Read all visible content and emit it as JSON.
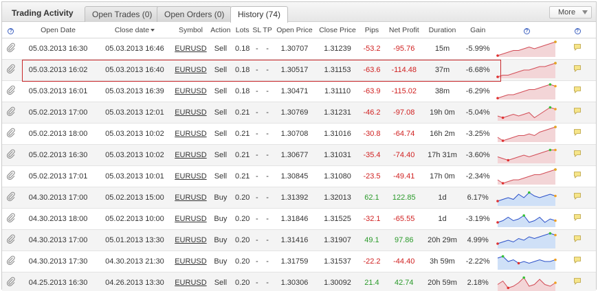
{
  "header": {
    "title": "Trading Activity",
    "tabs": [
      {
        "label": "Open Trades (0)"
      },
      {
        "label": "Open Orders (0)"
      },
      {
        "label": "History (74)"
      }
    ],
    "more_label": "More"
  },
  "columns": {
    "help": "?",
    "open_date": "Open Date",
    "close_date": "Close date",
    "symbol": "Symbol",
    "action": "Action",
    "lots": "Lots",
    "sl": "SL",
    "tp": "TP",
    "open_price": "Open Price",
    "close_price": "Close Price",
    "pips": "Pips",
    "net_profit": "Net Profit",
    "duration": "Duration",
    "gain": "Gain",
    "chart_help": "?",
    "note_help": "?"
  },
  "colors": {
    "sell_fill": "#f3d5d7",
    "sell_line": "#d24b55",
    "buy_fill": "#cfe0f7",
    "buy_line": "#2a4fc8",
    "high_marker": "#33c233",
    "low_marker": "#e03030",
    "end_marker": "#f0a020"
  },
  "rows": [
    {
      "open_date": "05.03.2013 16:30",
      "close_date": "05.03.2013 16:46",
      "symbol": "EURUSD",
      "action": "Sell",
      "lots": "0.18",
      "sl": "-",
      "tp": "-",
      "open_price": "1.30707",
      "close_price": "1.31239",
      "pips": "-53.2",
      "net_profit": "-95.76",
      "duration": "15m",
      "gain": "-5.99%"
    },
    {
      "open_date": "05.03.2013 16:02",
      "close_date": "05.03.2013 16:40",
      "symbol": "EURUSD",
      "action": "Sell",
      "lots": "0.18",
      "sl": "-",
      "tp": "-",
      "open_price": "1.30517",
      "close_price": "1.31153",
      "pips": "-63.6",
      "net_profit": "-114.48",
      "duration": "37m",
      "gain": "-6.68%"
    },
    {
      "open_date": "05.03.2013 16:01",
      "close_date": "05.03.2013 16:39",
      "symbol": "EURUSD",
      "action": "Sell",
      "lots": "0.18",
      "sl": "-",
      "tp": "-",
      "open_price": "1.30471",
      "close_price": "1.31110",
      "pips": "-63.9",
      "net_profit": "-115.02",
      "duration": "38m",
      "gain": "-6.29%"
    },
    {
      "open_date": "05.02.2013 17:00",
      "close_date": "05.03.2013 12:01",
      "symbol": "EURUSD",
      "action": "Sell",
      "lots": "0.21",
      "sl": "-",
      "tp": "-",
      "open_price": "1.30769",
      "close_price": "1.31231",
      "pips": "-46.2",
      "net_profit": "-97.08",
      "duration": "19h 0m",
      "gain": "-5.04%"
    },
    {
      "open_date": "05.02.2013 18:00",
      "close_date": "05.03.2013 10:02",
      "symbol": "EURUSD",
      "action": "Sell",
      "lots": "0.21",
      "sl": "-",
      "tp": "-",
      "open_price": "1.30708",
      "close_price": "1.31016",
      "pips": "-30.8",
      "net_profit": "-64.74",
      "duration": "16h 2m",
      "gain": "-3.25%"
    },
    {
      "open_date": "05.02.2013 16:30",
      "close_date": "05.03.2013 10:02",
      "symbol": "EURUSD",
      "action": "Sell",
      "lots": "0.21",
      "sl": "-",
      "tp": "-",
      "open_price": "1.30677",
      "close_price": "1.31031",
      "pips": "-35.4",
      "net_profit": "-74.40",
      "duration": "17h 31m",
      "gain": "-3.60%"
    },
    {
      "open_date": "05.02.2013 17:01",
      "close_date": "05.03.2013 10:01",
      "symbol": "EURUSD",
      "action": "Sell",
      "lots": "0.21",
      "sl": "-",
      "tp": "-",
      "open_price": "1.30845",
      "close_price": "1.31080",
      "pips": "-23.5",
      "net_profit": "-49.41",
      "duration": "17h 0m",
      "gain": "-2.34%"
    },
    {
      "open_date": "04.30.2013 17:00",
      "close_date": "05.02.2013 15:00",
      "symbol": "EURUSD",
      "action": "Buy",
      "lots": "0.20",
      "sl": "-",
      "tp": "-",
      "open_price": "1.31392",
      "close_price": "1.32013",
      "pips": "62.1",
      "net_profit": "122.85",
      "duration": "1d",
      "gain": "6.17%"
    },
    {
      "open_date": "04.30.2013 18:00",
      "close_date": "05.02.2013 10:00",
      "symbol": "EURUSD",
      "action": "Buy",
      "lots": "0.20",
      "sl": "-",
      "tp": "-",
      "open_price": "1.31846",
      "close_price": "1.31525",
      "pips": "-32.1",
      "net_profit": "-65.55",
      "duration": "1d",
      "gain": "-3.19%"
    },
    {
      "open_date": "04.30.2013 17:00",
      "close_date": "05.01.2013 13:30",
      "symbol": "EURUSD",
      "action": "Buy",
      "lots": "0.20",
      "sl": "-",
      "tp": "-",
      "open_price": "1.31416",
      "close_price": "1.31907",
      "pips": "49.1",
      "net_profit": "97.86",
      "duration": "20h 29m",
      "gain": "4.99%"
    },
    {
      "open_date": "04.30.2013 17:30",
      "close_date": "04.30.2013 21:30",
      "symbol": "EURUSD",
      "action": "Buy",
      "lots": "0.20",
      "sl": "-",
      "tp": "-",
      "open_price": "1.31759",
      "close_price": "1.31537",
      "pips": "-22.2",
      "net_profit": "-44.40",
      "duration": "3h 59m",
      "gain": "-2.22%"
    },
    {
      "open_date": "04.25.2013 16:30",
      "close_date": "04.26.2013 13:30",
      "symbol": "EURUSD",
      "action": "Sell",
      "lots": "0.20",
      "sl": "-",
      "tp": "-",
      "open_price": "1.30306",
      "close_price": "1.30092",
      "pips": "21.4",
      "net_profit": "42.74",
      "duration": "20h 59m",
      "gain": "2.18%"
    }
  ]
}
